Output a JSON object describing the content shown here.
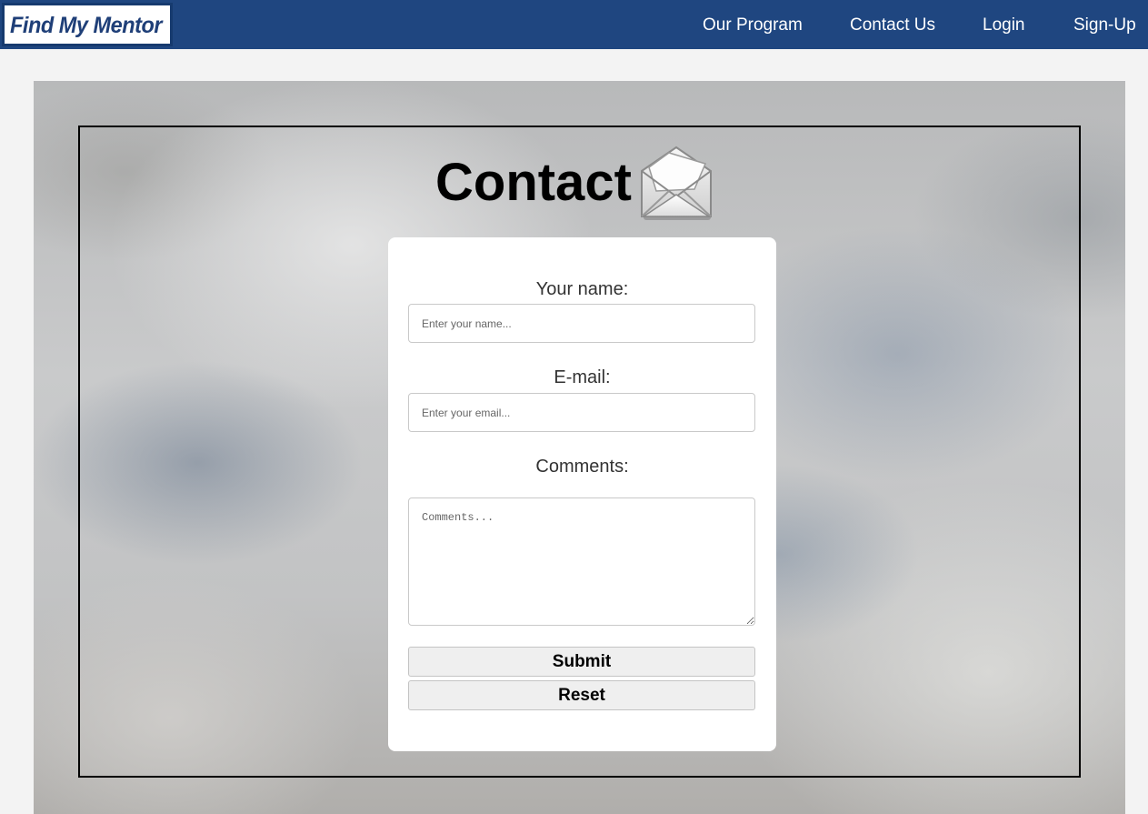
{
  "brand": {
    "logo_text": "Find My Mentor"
  },
  "nav": {
    "items": [
      {
        "label": "Our Program"
      },
      {
        "label": "Contact Us"
      },
      {
        "label": "Login"
      },
      {
        "label": "Sign-Up"
      }
    ]
  },
  "page": {
    "title": "Contact"
  },
  "form": {
    "name_label": "Your name:",
    "name_placeholder": "Enter your name...",
    "email_label": "E-mail:",
    "email_placeholder": "Enter your email...",
    "comments_label": "Comments:",
    "comments_placeholder": "Comments...",
    "submit_label": "Submit",
    "reset_label": "Reset"
  },
  "colors": {
    "navbar": "#1f4680",
    "logo_text": "#1f3f78",
    "page_background": "#f3f3f3"
  },
  "icons": {
    "title_icon": "envelope-icon"
  }
}
